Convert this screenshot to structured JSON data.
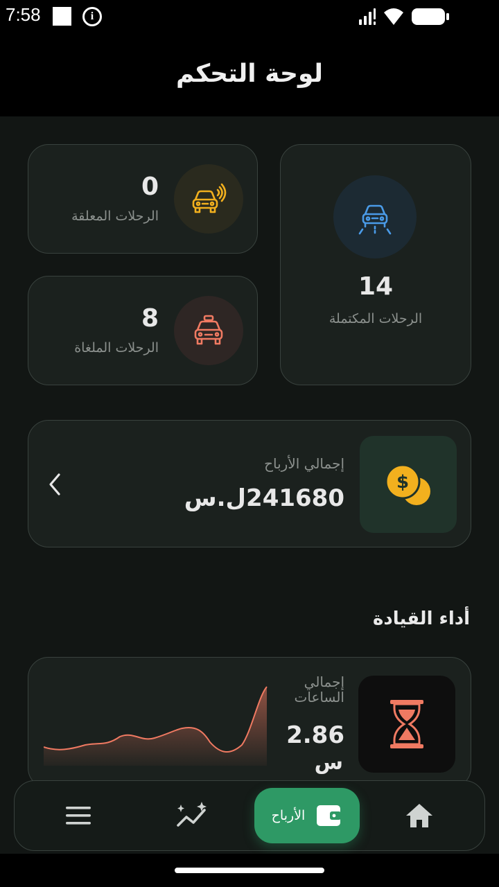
{
  "status_bar": {
    "time": "7:58",
    "icons": [
      "notification-square-icon",
      "info-icon",
      "signal-icon",
      "wifi-icon",
      "battery-icon"
    ]
  },
  "header": {
    "title": "لوحة التحكم"
  },
  "stats": {
    "completed": {
      "value": "14",
      "label": "الرحلات المكتملة",
      "icon": "car-front-icon",
      "color": "#4a9be8"
    },
    "pending": {
      "value": "0",
      "label": "الرحلات المعلقة",
      "icon": "car-signal-icon",
      "color": "#f2b01e"
    },
    "cancelled": {
      "value": "8",
      "label": "الرحلات الملغاة",
      "icon": "taxi-icon",
      "color": "#f07a62"
    }
  },
  "earnings": {
    "label": "إجمالي الأرباح",
    "amount": "241680ل.س",
    "icon": "coins-icon",
    "chevron_icon": "chevron-left-icon",
    "color": "#f2b01e"
  },
  "performance": {
    "section_title": "أداء القيادة",
    "hours_label": "إجمالي الساعات",
    "hours_value": "2.86",
    "hours_unit": "س",
    "icon": "hourglass-icon",
    "color": "#f07a62"
  },
  "nav": {
    "items": [
      {
        "name": "menu",
        "icon": "menu-icon"
      },
      {
        "name": "analytics",
        "icon": "sparkle-chart-icon"
      },
      {
        "name": "earnings",
        "icon": "wallet-icon",
        "label": "الأرباح",
        "active": true
      },
      {
        "name": "home",
        "icon": "home-icon"
      }
    ],
    "active_color": "#2e9965"
  }
}
